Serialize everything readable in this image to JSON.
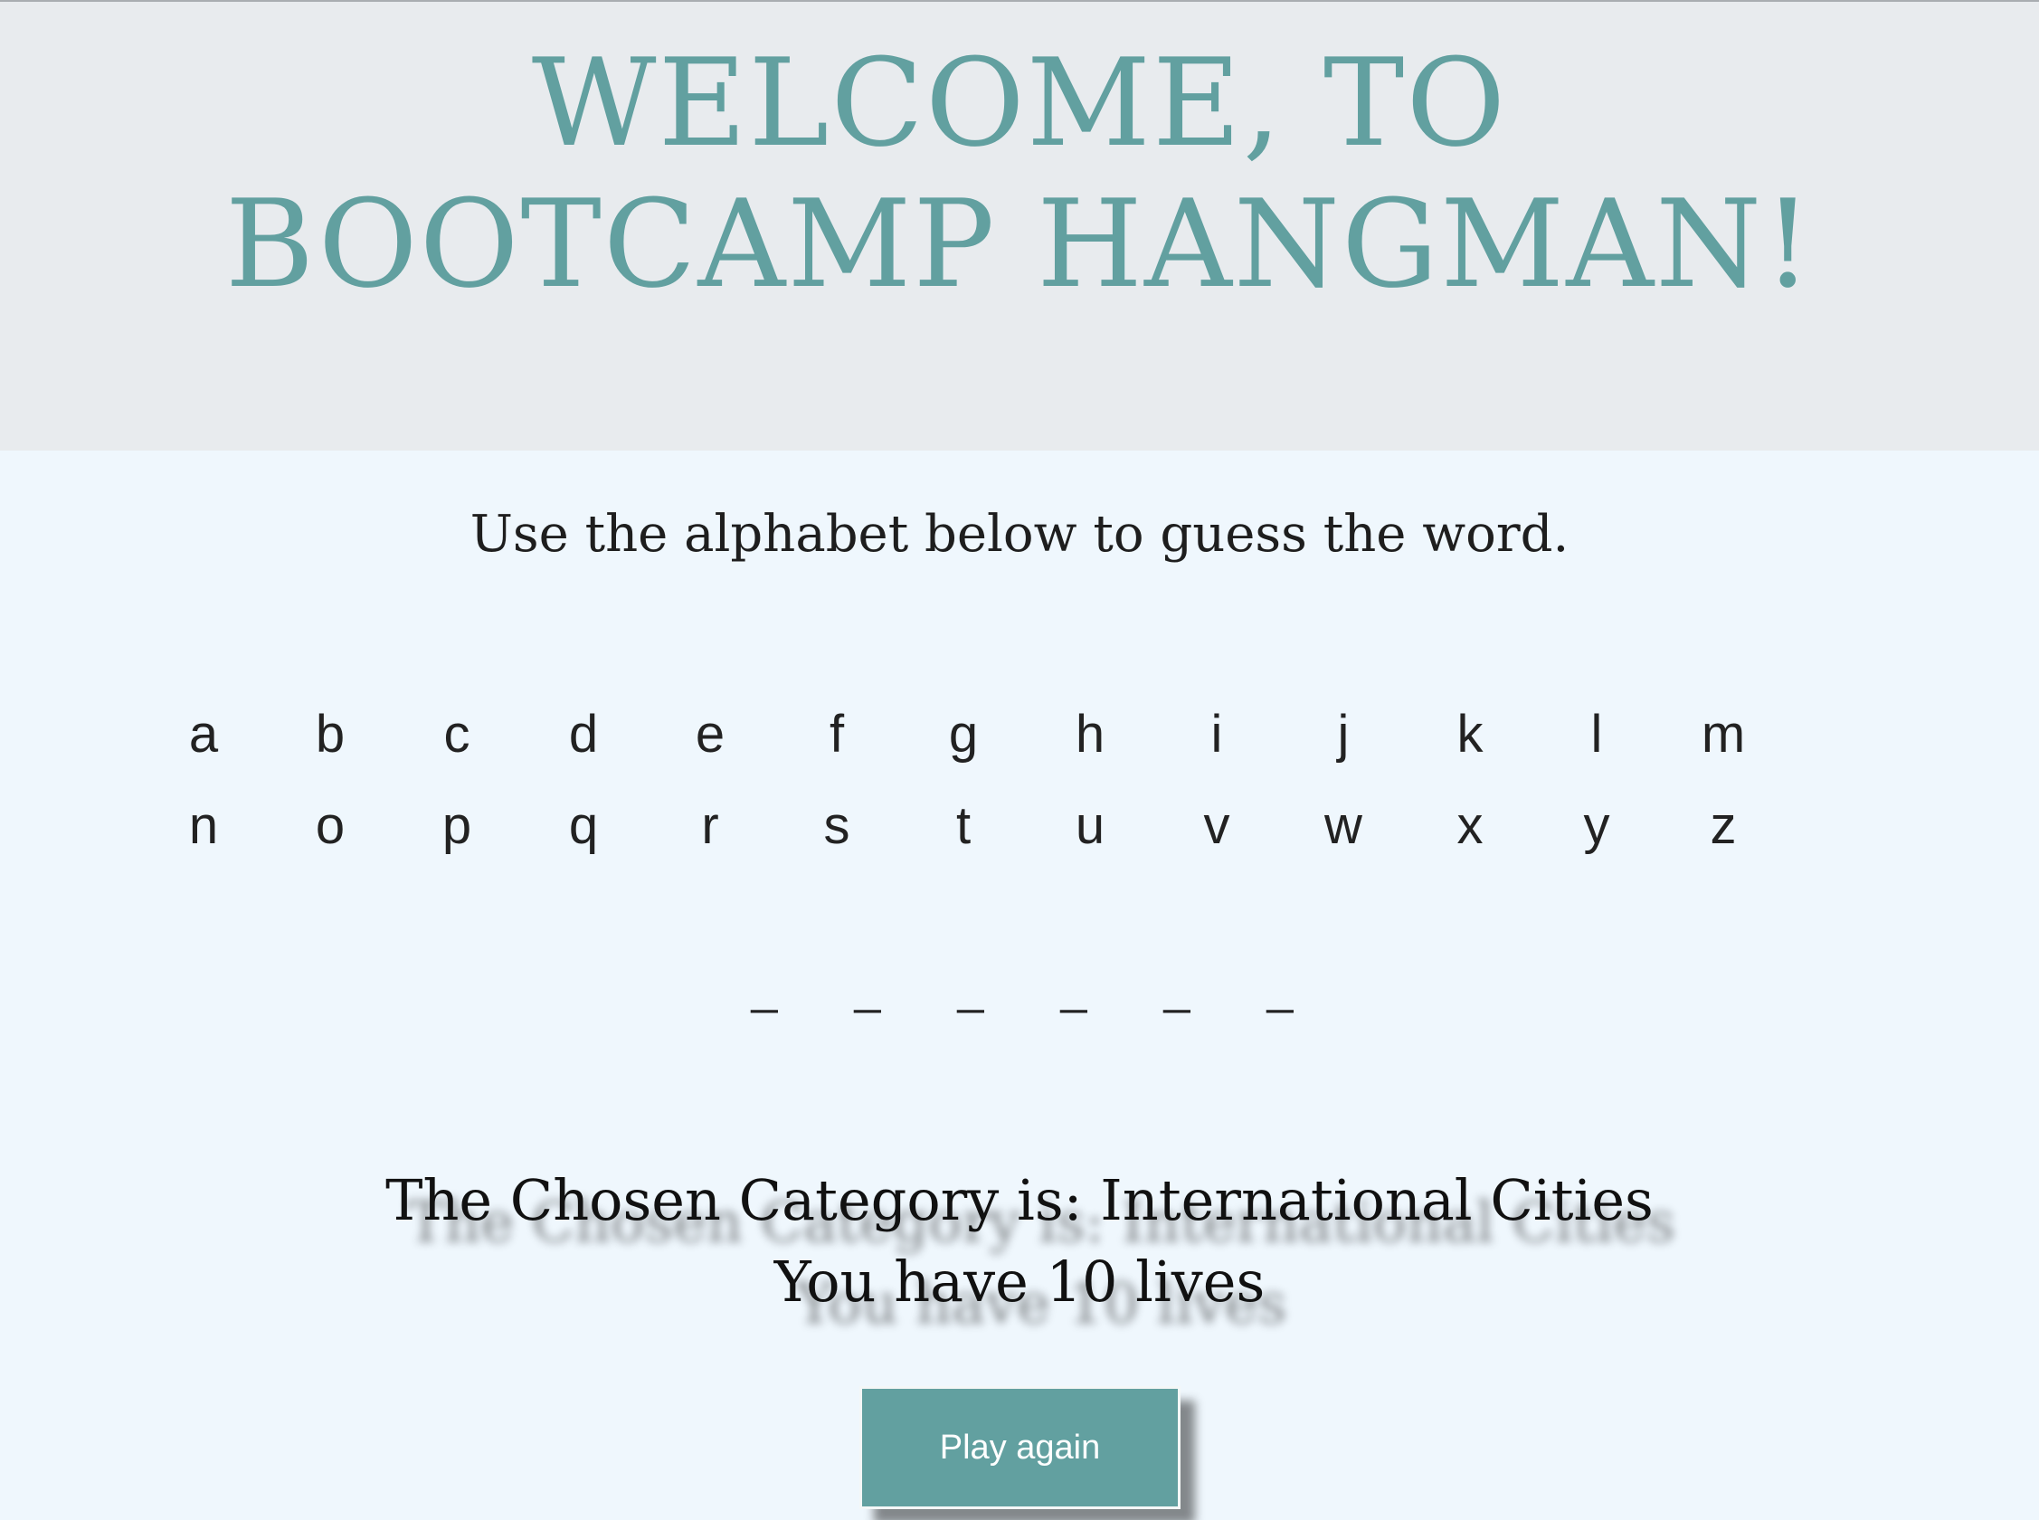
{
  "header": {
    "title_line1": "WELCOME, TO",
    "title_line2": "BOOTCAMP HANGMAN!"
  },
  "instructions": "Use the alphabet below to guess the word.",
  "alphabet": [
    "a",
    "b",
    "c",
    "d",
    "e",
    "f",
    "g",
    "h",
    "i",
    "j",
    "k",
    "l",
    "m",
    "n",
    "o",
    "p",
    "q",
    "r",
    "s",
    "t",
    "u",
    "v",
    "w",
    "x",
    "y",
    "z"
  ],
  "word_blanks": [
    "_",
    "_",
    "_",
    "_",
    "_",
    "_"
  ],
  "status": {
    "category": "The Chosen Category is: International Cities",
    "lives": "You have 10 lives"
  },
  "play_again_label": "Play again",
  "colors": {
    "accent": "#62a0a0",
    "header_bg": "#e8ebee",
    "page_bg": "#eff7fd"
  }
}
